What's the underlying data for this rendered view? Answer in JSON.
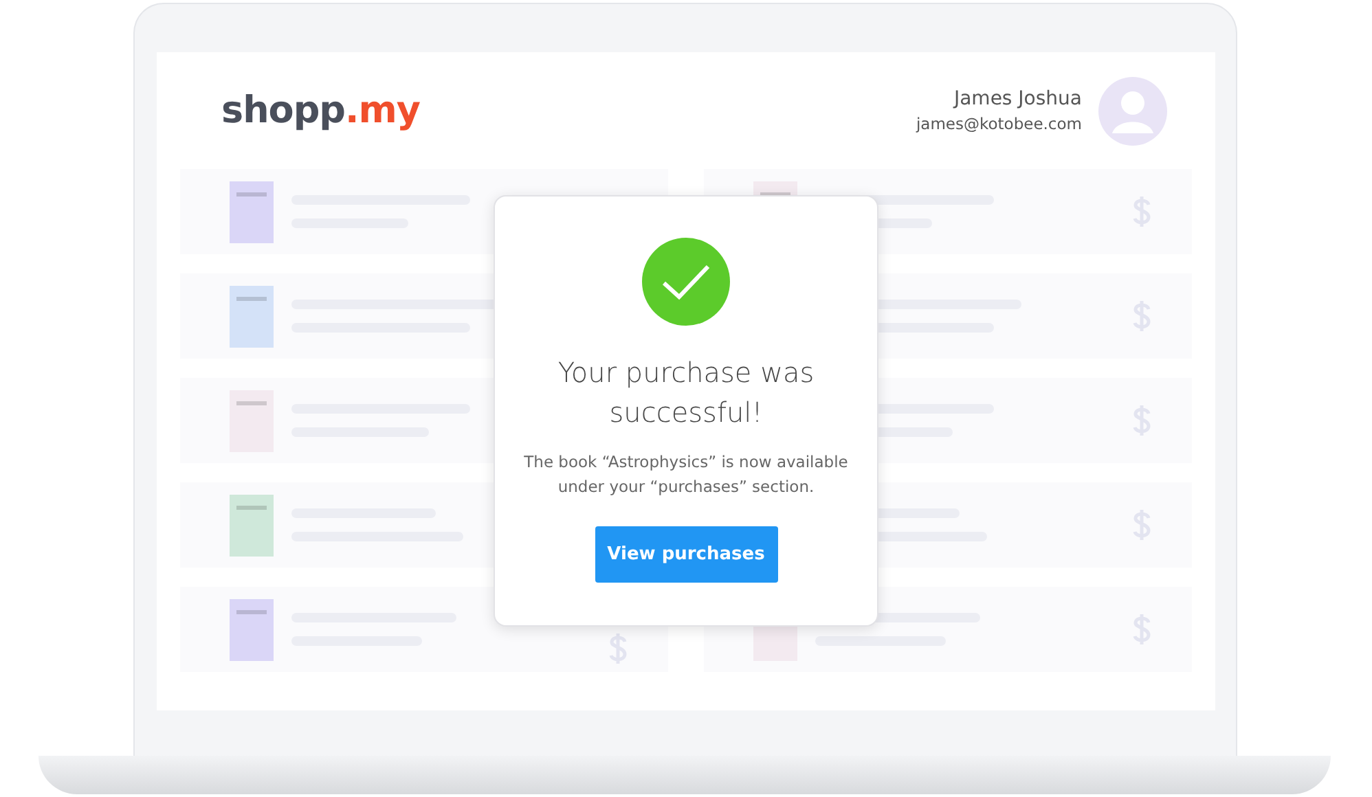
{
  "logo": {
    "name": "shopp",
    "suffix": ".my"
  },
  "user": {
    "name": "James Joshua",
    "email": "james@kotobee.com"
  },
  "books_left": [
    {
      "color": "#dad6f7",
      "dollar": false
    },
    {
      "color": "#d4e2f8",
      "dollar": false
    },
    {
      "color": "#f3eaf0",
      "dollar": false
    },
    {
      "color": "#cfe8da",
      "dollar": false
    },
    {
      "color": "#dad6f7",
      "dollar": true
    }
  ],
  "books_right": [
    {
      "color": "#f3eaf0",
      "dollar": true
    },
    {
      "dollar": true
    },
    {
      "dollar": true
    },
    {
      "dollar": true
    },
    {
      "color": "#f3eaf0",
      "dollar": true
    }
  ],
  "dialog": {
    "title": "Your purchase was successful!",
    "message": "The book “Astrophysics” is now available under your “purchases” section.",
    "button": "View purchases"
  }
}
